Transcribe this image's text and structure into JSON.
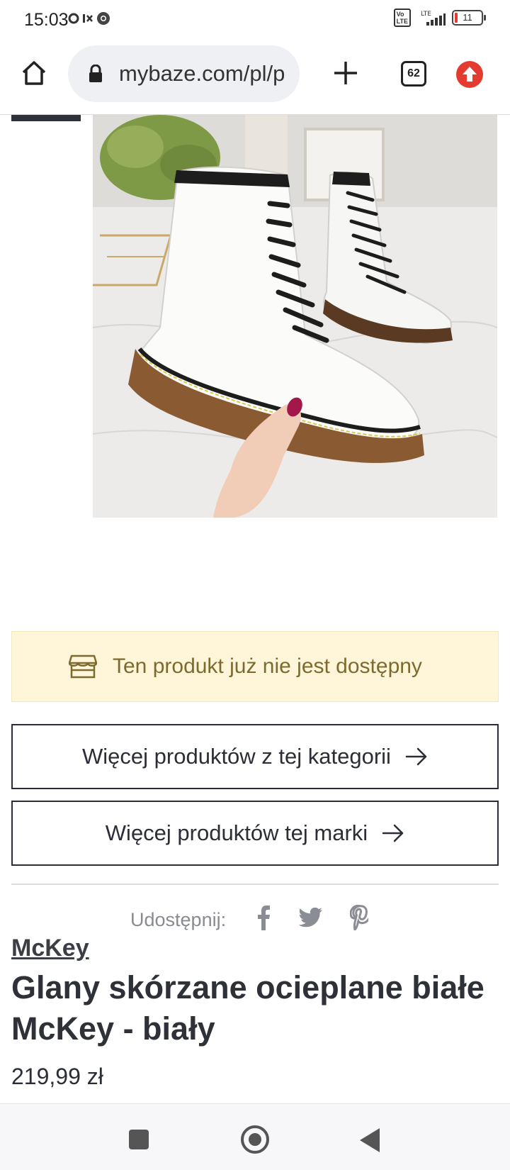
{
  "status_bar": {
    "time": "15:03",
    "battery": "11"
  },
  "browser": {
    "url": "mybaze.com/pl/p",
    "tab_count": "62"
  },
  "product": {
    "unavailable_text": "Ten produkt już nie jest dostępny",
    "more_category_label": "Więcej produktów z tej kategorii",
    "more_brand_label": "Więcej produktów tej marki",
    "share_label": "Udostępnij:",
    "brand": "McKey",
    "title": "Glany skórzane ocieplane białe McKey - biały",
    "price": "219,99 zł"
  },
  "colors": {
    "banner_bg": "#fff6d9",
    "banner_text": "#7d6a2e",
    "update_red": "#e53a2f",
    "text_dark": "#2b2e36"
  },
  "icons": [
    "home-icon",
    "lock-icon",
    "plus-icon",
    "tab-switcher-icon",
    "update-icon",
    "shop-icon",
    "arrow-right-icon",
    "facebook-icon",
    "twitter-icon",
    "pinterest-icon"
  ]
}
